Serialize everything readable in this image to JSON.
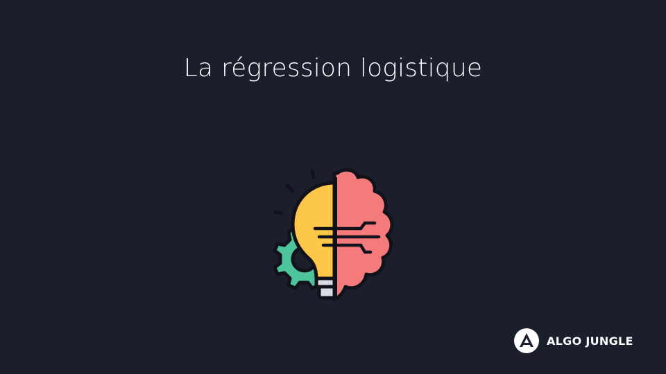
{
  "title": "La régression logistique",
  "illustration": {
    "icon": "brain-lightbulb-gear-icon",
    "colors": {
      "bulb": "#fdc84a",
      "brain": "#f47a7c",
      "gear": "#4dc49b",
      "outline": "#12121a",
      "base": "#d8dce3"
    }
  },
  "brand": {
    "icon": "algo-jungle-logo-icon",
    "name": "ALGO JUNGLE"
  },
  "colors": {
    "background": "#1b1f2c",
    "text": "#ffffff"
  }
}
